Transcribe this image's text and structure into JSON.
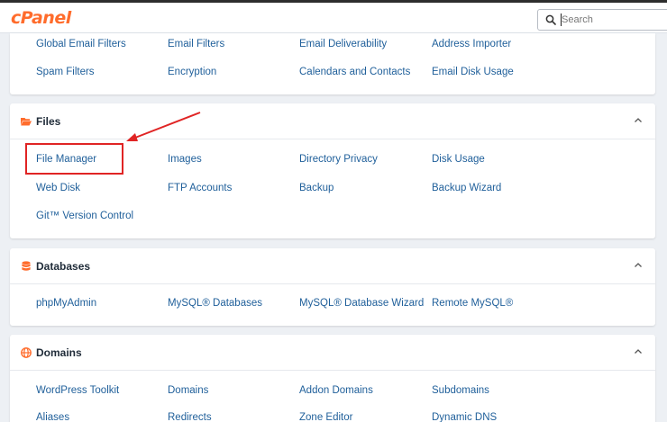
{
  "header": {
    "logo": "cPanel",
    "search_placeholder": "Search"
  },
  "email_section": {
    "rows": [
      [
        "Global Email Filters",
        "Email Filters",
        "Email Deliverability",
        "Address Importer"
      ],
      [
        "Spam Filters",
        "Encryption",
        "Calendars and Contacts",
        "Email Disk Usage"
      ]
    ]
  },
  "files": {
    "title": "Files",
    "rows": [
      [
        "File Manager",
        "Images",
        "Directory Privacy",
        "Disk Usage"
      ],
      [
        "Web Disk",
        "FTP Accounts",
        "Backup",
        "Backup Wizard"
      ],
      [
        "Git™ Version Control"
      ]
    ]
  },
  "databases": {
    "title": "Databases",
    "rows": [
      [
        "phpMyAdmin",
        "MySQL® Databases",
        "MySQL® Database Wizard",
        "Remote MySQL®"
      ]
    ]
  },
  "domains": {
    "title": "Domains",
    "rows": [
      [
        "WordPress Toolkit",
        "Domains",
        "Addon Domains",
        "Subdomains"
      ],
      [
        "Aliases",
        "Redirects",
        "Zone Editor",
        "Dynamic DNS"
      ]
    ]
  },
  "colors": {
    "brand": "#ff6c2c",
    "link": "#1f5f9a",
    "annotation": "#e02424"
  },
  "icons": {
    "files": "folder-icon",
    "databases": "database-icon",
    "domains": "globe-icon",
    "collapse": "chevron-up-icon",
    "search": "search-icon"
  }
}
